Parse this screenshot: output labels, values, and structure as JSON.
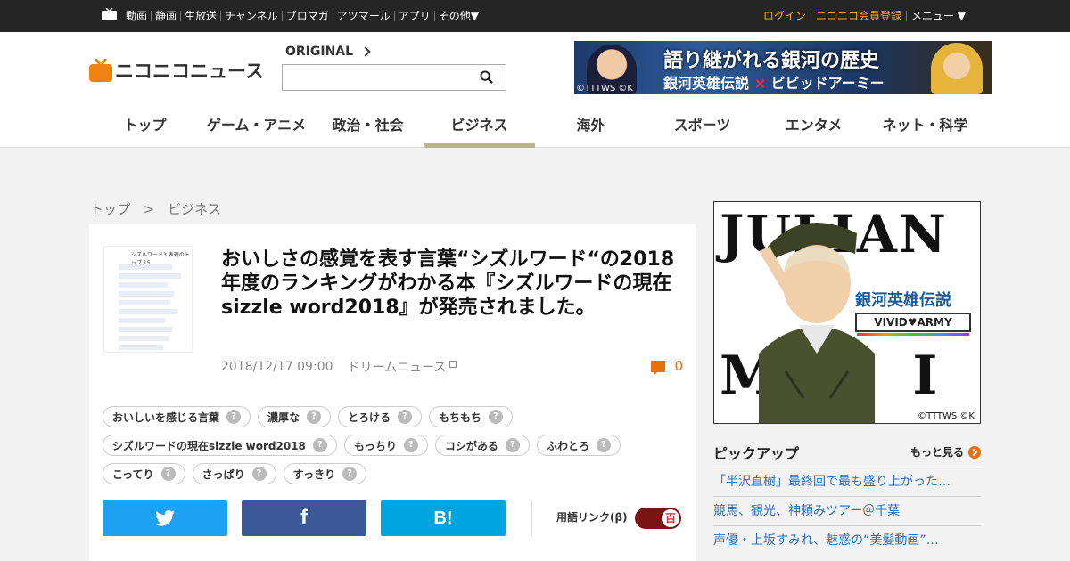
{
  "topbar": {
    "links": [
      "動画",
      "静画",
      "生放送",
      "チャンネル",
      "ブロマガ",
      "アツマール",
      "アプリ",
      "その他▼"
    ],
    "login": "ログイン",
    "register": "ニコニコ会員登録",
    "menu": "メニュー ▼"
  },
  "header": {
    "logo_text": "ニコニコニュース",
    "original_label": "ORIGINAL",
    "search_placeholder": "",
    "ad": {
      "headline": "語り継がれる銀河の歴史",
      "subline_left": "銀河英雄伝説",
      "subline_x": "×",
      "subline_right": "ビビッドアーミー",
      "copyright": "©TTTWS ©K"
    }
  },
  "nav": [
    "トップ",
    "ゲーム・アニメ",
    "政治・社会",
    "ビジネス",
    "海外",
    "スポーツ",
    "エンタメ",
    "ネット・科学"
  ],
  "nav_active": "ビジネス",
  "breadcrumb": {
    "home": "トップ",
    "sep": ">",
    "current": "ビジネス"
  },
  "article": {
    "title": "おいしさの感覚を表す言葉“シズルワード“の2018年度のランキングがわかる本『シズルワードの現在sizzle word2018』が発売されました。",
    "date": "2018/12/17 09:00",
    "source": "ドリームニュース",
    "comment_count": "0",
    "thumb_title": "シズルワード3 表現のトップ 15",
    "tags": [
      "おいしいを感じる言葉",
      "濃厚な",
      "とろける",
      "もちもち",
      "シズルワードの現在sizzle word2018",
      "もっちり",
      "コシがある",
      "ふわとろ",
      "こってり",
      "さっぱり",
      "すっきり"
    ],
    "tag_help": "?",
    "share": {
      "twitter": "Twitter",
      "facebook": "f",
      "hatena": "B!"
    },
    "term_link_label": "用語リンク(β)",
    "term_toggle": "百"
  },
  "sidebar": {
    "ad": {
      "word1": "JULIAN",
      "word2": "MINTZ",
      "title_jp": "銀河英雄伝説",
      "badge": "VIVID♥ARMY",
      "copyright": "©TTTWS ©K"
    },
    "pickup_title": "ピックアップ",
    "pickup_more": "もっと見る",
    "pickup_items": [
      "「半沢直樹」最終回で最も盛り上がった…",
      "競馬、観光、神頼みツアー＠千葉",
      "声優・上坂すみれ、魅惑の“美髪動画”…"
    ]
  },
  "colors": {
    "accent": "#e8700c",
    "twitter": "#1da1f2",
    "facebook": "#3b5998",
    "hatena": "#00a4de",
    "nav_active": "#b9b38f"
  }
}
